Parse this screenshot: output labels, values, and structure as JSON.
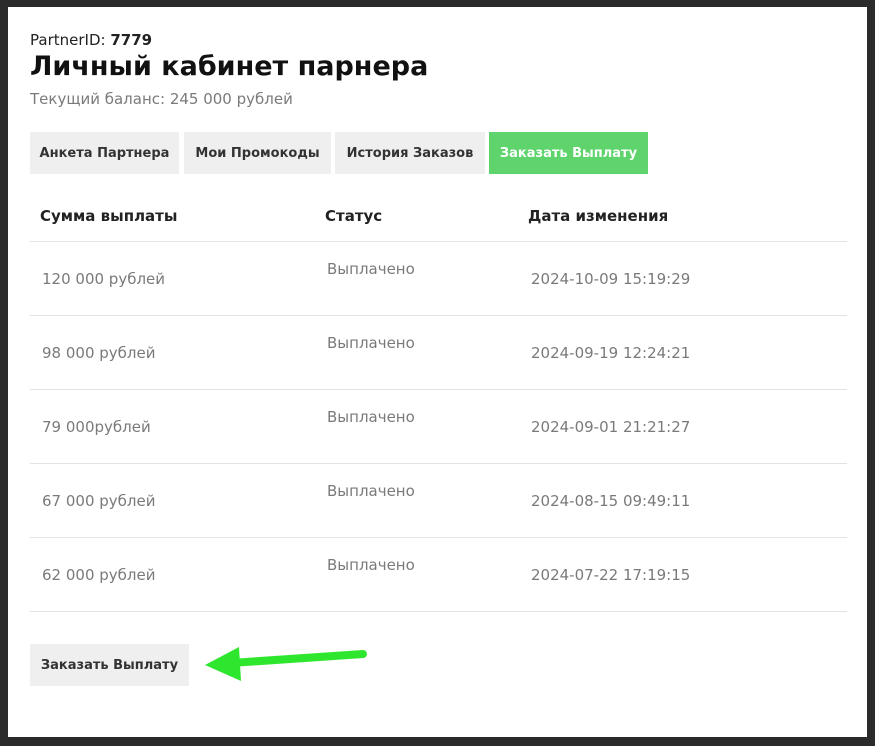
{
  "header": {
    "partner_id_label": "PartnerID:",
    "partner_id_value": "7779",
    "title": "Личный кабинет парнера",
    "balance": "Текущий баланс: 245 000 рублей"
  },
  "tabs": [
    {
      "label": "Анкета Партнера",
      "active": false
    },
    {
      "label": "Мои Промокоды",
      "active": false
    },
    {
      "label": "История Заказов",
      "active": false
    },
    {
      "label": "Заказать Выплату",
      "active": true
    }
  ],
  "table": {
    "columns": [
      "Сумма выплаты",
      "Статус",
      "Дата изменения"
    ],
    "rows": [
      {
        "amount": "120 000 рублей",
        "status": "Выплачено",
        "date": "2024-10-09 15:19:29"
      },
      {
        "amount": "98 000 рублей",
        "status": "Выплачено",
        "date": "2024-09-19 12:24:21"
      },
      {
        "amount": "79 000рублей",
        "status": "Выплачено",
        "date": "2024-09-01 21:21:27"
      },
      {
        "amount": "67 000 рублей",
        "status": "Выплачено",
        "date": "2024-08-15 09:49:11"
      },
      {
        "amount": "62 000 рублей",
        "status": "Выплачено",
        "date": "2024-07-22 17:19:15"
      }
    ]
  },
  "actions": {
    "order_payout_label": "Заказать Выплату"
  },
  "colors": {
    "accent": "#5fd46d",
    "arrow": "#2ee62e",
    "frame": "#2b2b2b",
    "button_bg": "#efefef"
  },
  "annotation": {
    "icon": "arrow-left-icon"
  }
}
